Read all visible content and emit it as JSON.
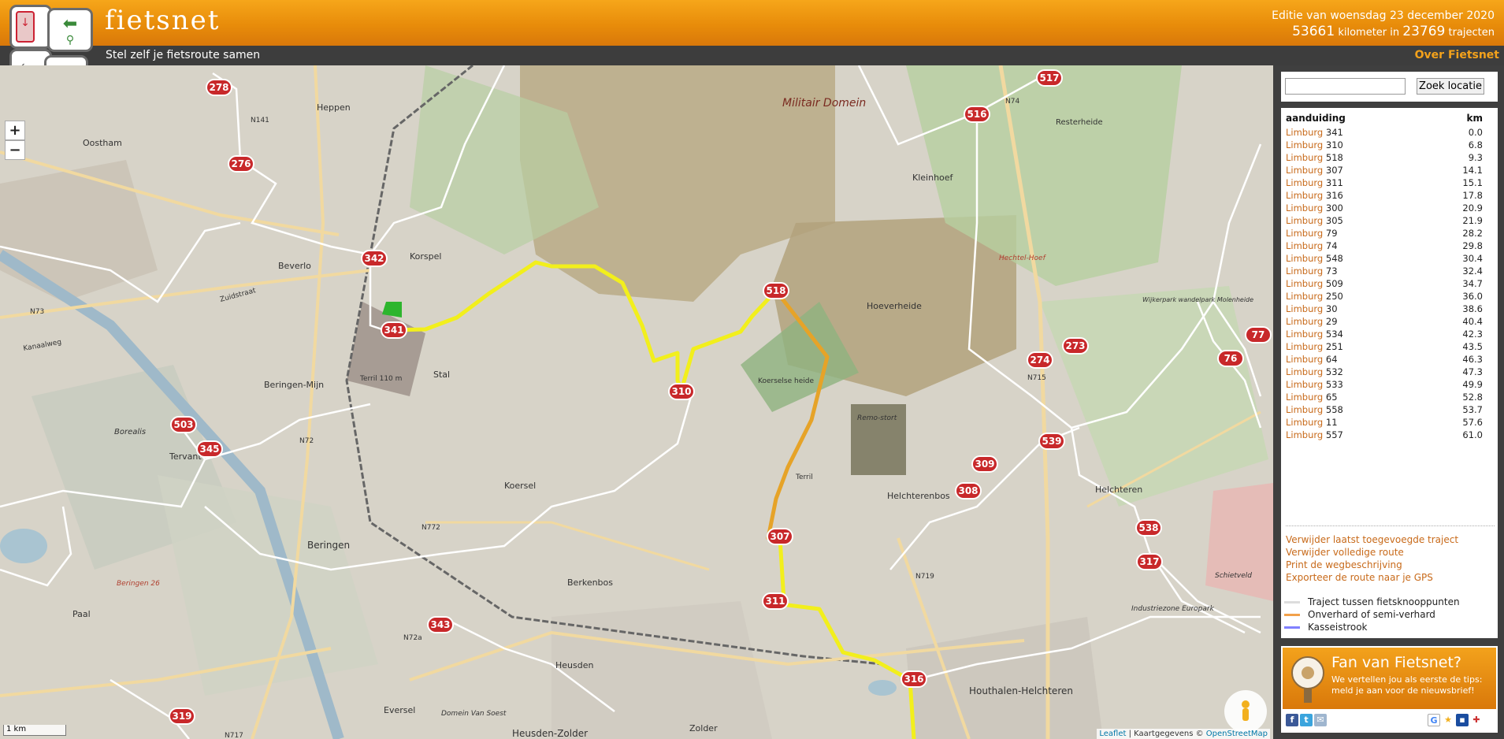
{
  "header": {
    "logo": "fietsnet",
    "tagline": "Stel zelf je fietsroute samen",
    "edition": "Editie van woensdag 23 december 2020",
    "km_count": "53661",
    "km_label": "kilometer in",
    "route_count": "23769",
    "route_label": "trajecten",
    "about_link": "Over Fietsnet"
  },
  "map": {
    "zoom_in": "+",
    "zoom_out": "−",
    "scale": "1 km",
    "attribution_leaflet": "Leaflet",
    "attribution_sep": " | Kaartgegevens © ",
    "attribution_osm": "OpenStreetMap",
    "node_markers": [
      "341",
      "342",
      "278",
      "276",
      "503",
      "345",
      "310",
      "518",
      "307",
      "311",
      "316",
      "309",
      "308",
      "539",
      "274",
      "273",
      "516",
      "517",
      "538",
      "317",
      "76",
      "77",
      "343",
      "319"
    ],
    "place_labels": [
      "Militair Domein",
      "Heppen",
      "Oostham",
      "Beverlo",
      "Korspel",
      "Beringen-Mijn",
      "Stal",
      "Koersel",
      "Beringen",
      "Tervant",
      "Paal",
      "Berkenbos",
      "Heusden",
      "Zolder",
      "Heusden-Zolder",
      "Houthalen-Helchteren",
      "Helchterenbos",
      "Helchteren",
      "Kleinhoef",
      "Hoeverheide",
      "Resterheide",
      "Koersel­se heide",
      "Remo-stort",
      "Terril",
      "Terril 110 m",
      "Borealis",
      "Industriezone Europark",
      "Schietveld",
      "Wijkerpark wandelpark Molenheide",
      "Hechtel-Hoef",
      "Beringen 26",
      "Eversel",
      "Domein Van Soest"
    ],
    "road_labels": [
      "N141",
      "N73",
      "N72",
      "N772",
      "N72a",
      "N719",
      "N715",
      "N74",
      "N717",
      "Zuidstraat",
      "Kanaalweg"
    ],
    "route_color": "#f2ef1c",
    "route_unpaved_color": "#e6a328"
  },
  "panel": {
    "search_placeholder": "",
    "search_button": "Zoek locatie",
    "col_label": "aanduiding",
    "col_km": "km",
    "route": [
      {
        "prov": "Limburg",
        "node": "341",
        "km": "0.0"
      },
      {
        "prov": "Limburg",
        "node": "310",
        "km": "6.8"
      },
      {
        "prov": "Limburg",
        "node": "518",
        "km": "9.3"
      },
      {
        "prov": "Limburg",
        "node": "307",
        "km": "14.1"
      },
      {
        "prov": "Limburg",
        "node": "311",
        "km": "15.1"
      },
      {
        "prov": "Limburg",
        "node": "316",
        "km": "17.8"
      },
      {
        "prov": "Limburg",
        "node": "300",
        "km": "20.9"
      },
      {
        "prov": "Limburg",
        "node": "305",
        "km": "21.9"
      },
      {
        "prov": "Limburg",
        "node": "79",
        "km": "28.2"
      },
      {
        "prov": "Limburg",
        "node": "74",
        "km": "29.8"
      },
      {
        "prov": "Limburg",
        "node": "548",
        "km": "30.4"
      },
      {
        "prov": "Limburg",
        "node": "73",
        "km": "32.4"
      },
      {
        "prov": "Limburg",
        "node": "509",
        "km": "34.7"
      },
      {
        "prov": "Limburg",
        "node": "250",
        "km": "36.0"
      },
      {
        "prov": "Limburg",
        "node": "30",
        "km": "38.6"
      },
      {
        "prov": "Limburg",
        "node": "29",
        "km": "40.4"
      },
      {
        "prov": "Limburg",
        "node": "534",
        "km": "42.3"
      },
      {
        "prov": "Limburg",
        "node": "251",
        "km": "43.5"
      },
      {
        "prov": "Limburg",
        "node": "64",
        "km": "46.3"
      },
      {
        "prov": "Limburg",
        "node": "532",
        "km": "47.3"
      },
      {
        "prov": "Limburg",
        "node": "533",
        "km": "49.9"
      },
      {
        "prov": "Limburg",
        "node": "65",
        "km": "52.8"
      },
      {
        "prov": "Limburg",
        "node": "558",
        "km": "53.7"
      },
      {
        "prov": "Limburg",
        "node": "11",
        "km": "57.6"
      },
      {
        "prov": "Limburg",
        "node": "557",
        "km": "61.0"
      }
    ],
    "actions": [
      "Verwijder laatst toegevoegde traject",
      "Verwijder volledige route",
      "Print de wegbeschrijving",
      "Exporteer de route naar je GPS"
    ],
    "legend": [
      {
        "label": "Traject tussen fietsknooppunten",
        "color": "#dddddd"
      },
      {
        "label": "Onverhard of semi-verhard",
        "color": "#f2a14a"
      },
      {
        "label": "Kasseistrook",
        "color": "#8080ff"
      }
    ],
    "fan_title": "Fan van Fietsnet?",
    "fan_sub": "We vertellen jou als eerste de tips: meld je aan voor de nieuwsbrief!",
    "social_icons": [
      "facebook-icon",
      "twitter-icon",
      "mail-icon",
      "google-icon",
      "star-icon",
      "delicious-icon",
      "share-icon"
    ]
  }
}
